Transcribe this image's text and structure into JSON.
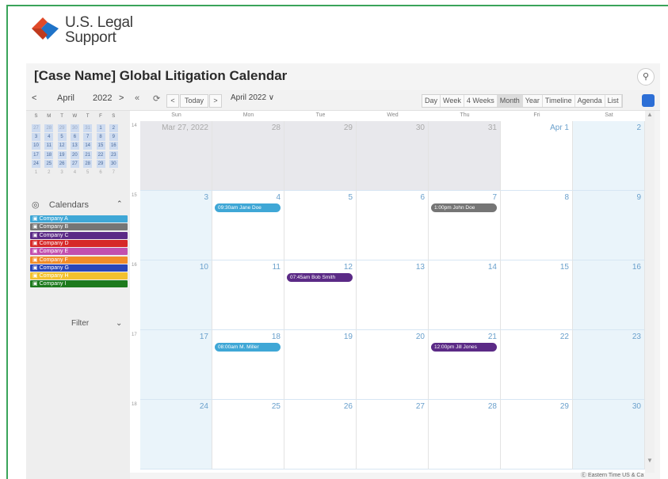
{
  "logo": {
    "line1": "U.S. Legal",
    "line2": "Support"
  },
  "title": "[Case Name] Global Litigation Calendar",
  "search": {
    "icon": "search-icon"
  },
  "mini": {
    "month": "April",
    "year": "2022",
    "dow": [
      "S",
      "M",
      "T",
      "W",
      "T",
      "F",
      "S"
    ],
    "rows": [
      [
        "27",
        "28",
        "29",
        "30",
        "31",
        "1",
        "2"
      ],
      [
        "3",
        "4",
        "5",
        "6",
        "7",
        "8",
        "9"
      ],
      [
        "10",
        "11",
        "12",
        "13",
        "14",
        "15",
        "16"
      ],
      [
        "17",
        "18",
        "19",
        "20",
        "21",
        "22",
        "23"
      ],
      [
        "24",
        "25",
        "26",
        "27",
        "28",
        "29",
        "30"
      ],
      [
        "1",
        "2",
        "3",
        "4",
        "5",
        "6",
        "7"
      ]
    ]
  },
  "toolbar": {
    "today": "Today",
    "current": "April 2022 ∨",
    "views": [
      "Day",
      "Week",
      "4 Weeks",
      "Month",
      "Year",
      "Timeline",
      "Agenda",
      "List"
    ],
    "active_view": "Month"
  },
  "calendars": {
    "heading": "Calendars",
    "items": [
      {
        "label": "Company A",
        "color": "#3fa7d6"
      },
      {
        "label": "Company B",
        "color": "#757575"
      },
      {
        "label": "Company C",
        "color": "#5b2a86"
      },
      {
        "label": "Company D",
        "color": "#d62828"
      },
      {
        "label": "Company E",
        "color": "#c24fae"
      },
      {
        "label": "Company F",
        "color": "#f28c28"
      },
      {
        "label": "Company G",
        "color": "#2a46b8"
      },
      {
        "label": "Company H",
        "color": "#f2c12e"
      },
      {
        "label": "Company I",
        "color": "#1d7a1d"
      }
    ],
    "filter": "Filter"
  },
  "weekdays": [
    "Sun",
    "Mon",
    "Tue",
    "Wed",
    "Thu",
    "Fri",
    "Sat"
  ],
  "weeks": [
    {
      "num": "14",
      "days": [
        "Mar 27, 2022",
        "28",
        "29",
        "30",
        "31",
        "Apr 1",
        "2"
      ]
    },
    {
      "num": "15",
      "days": [
        "3",
        "4",
        "5",
        "6",
        "7",
        "8",
        "9"
      ]
    },
    {
      "num": "16",
      "days": [
        "10",
        "11",
        "12",
        "13",
        "14",
        "15",
        "16"
      ]
    },
    {
      "num": "17",
      "days": [
        "17",
        "18",
        "19",
        "20",
        "21",
        "22",
        "23"
      ]
    },
    {
      "num": "18",
      "days": [
        "24",
        "25",
        "26",
        "27",
        "28",
        "29",
        "30"
      ]
    }
  ],
  "events": [
    {
      "label": "09:30am Jane Doe",
      "color": "#3fa7d6",
      "week": 1,
      "day": 1
    },
    {
      "label": "1:00pm John Doe",
      "color": "#757575",
      "week": 1,
      "day": 4
    },
    {
      "label": "07:45am Bob Smith",
      "color": "#5b2a86",
      "week": 2,
      "day": 2
    },
    {
      "label": "08:00am M. Miller",
      "color": "#3fa7d6",
      "week": 3,
      "day": 1
    },
    {
      "label": "12:00pm Jill Jones",
      "color": "#5b2a86",
      "week": 3,
      "day": 4
    }
  ],
  "timezone": "Ⓔ Eastern Time US & Ca"
}
